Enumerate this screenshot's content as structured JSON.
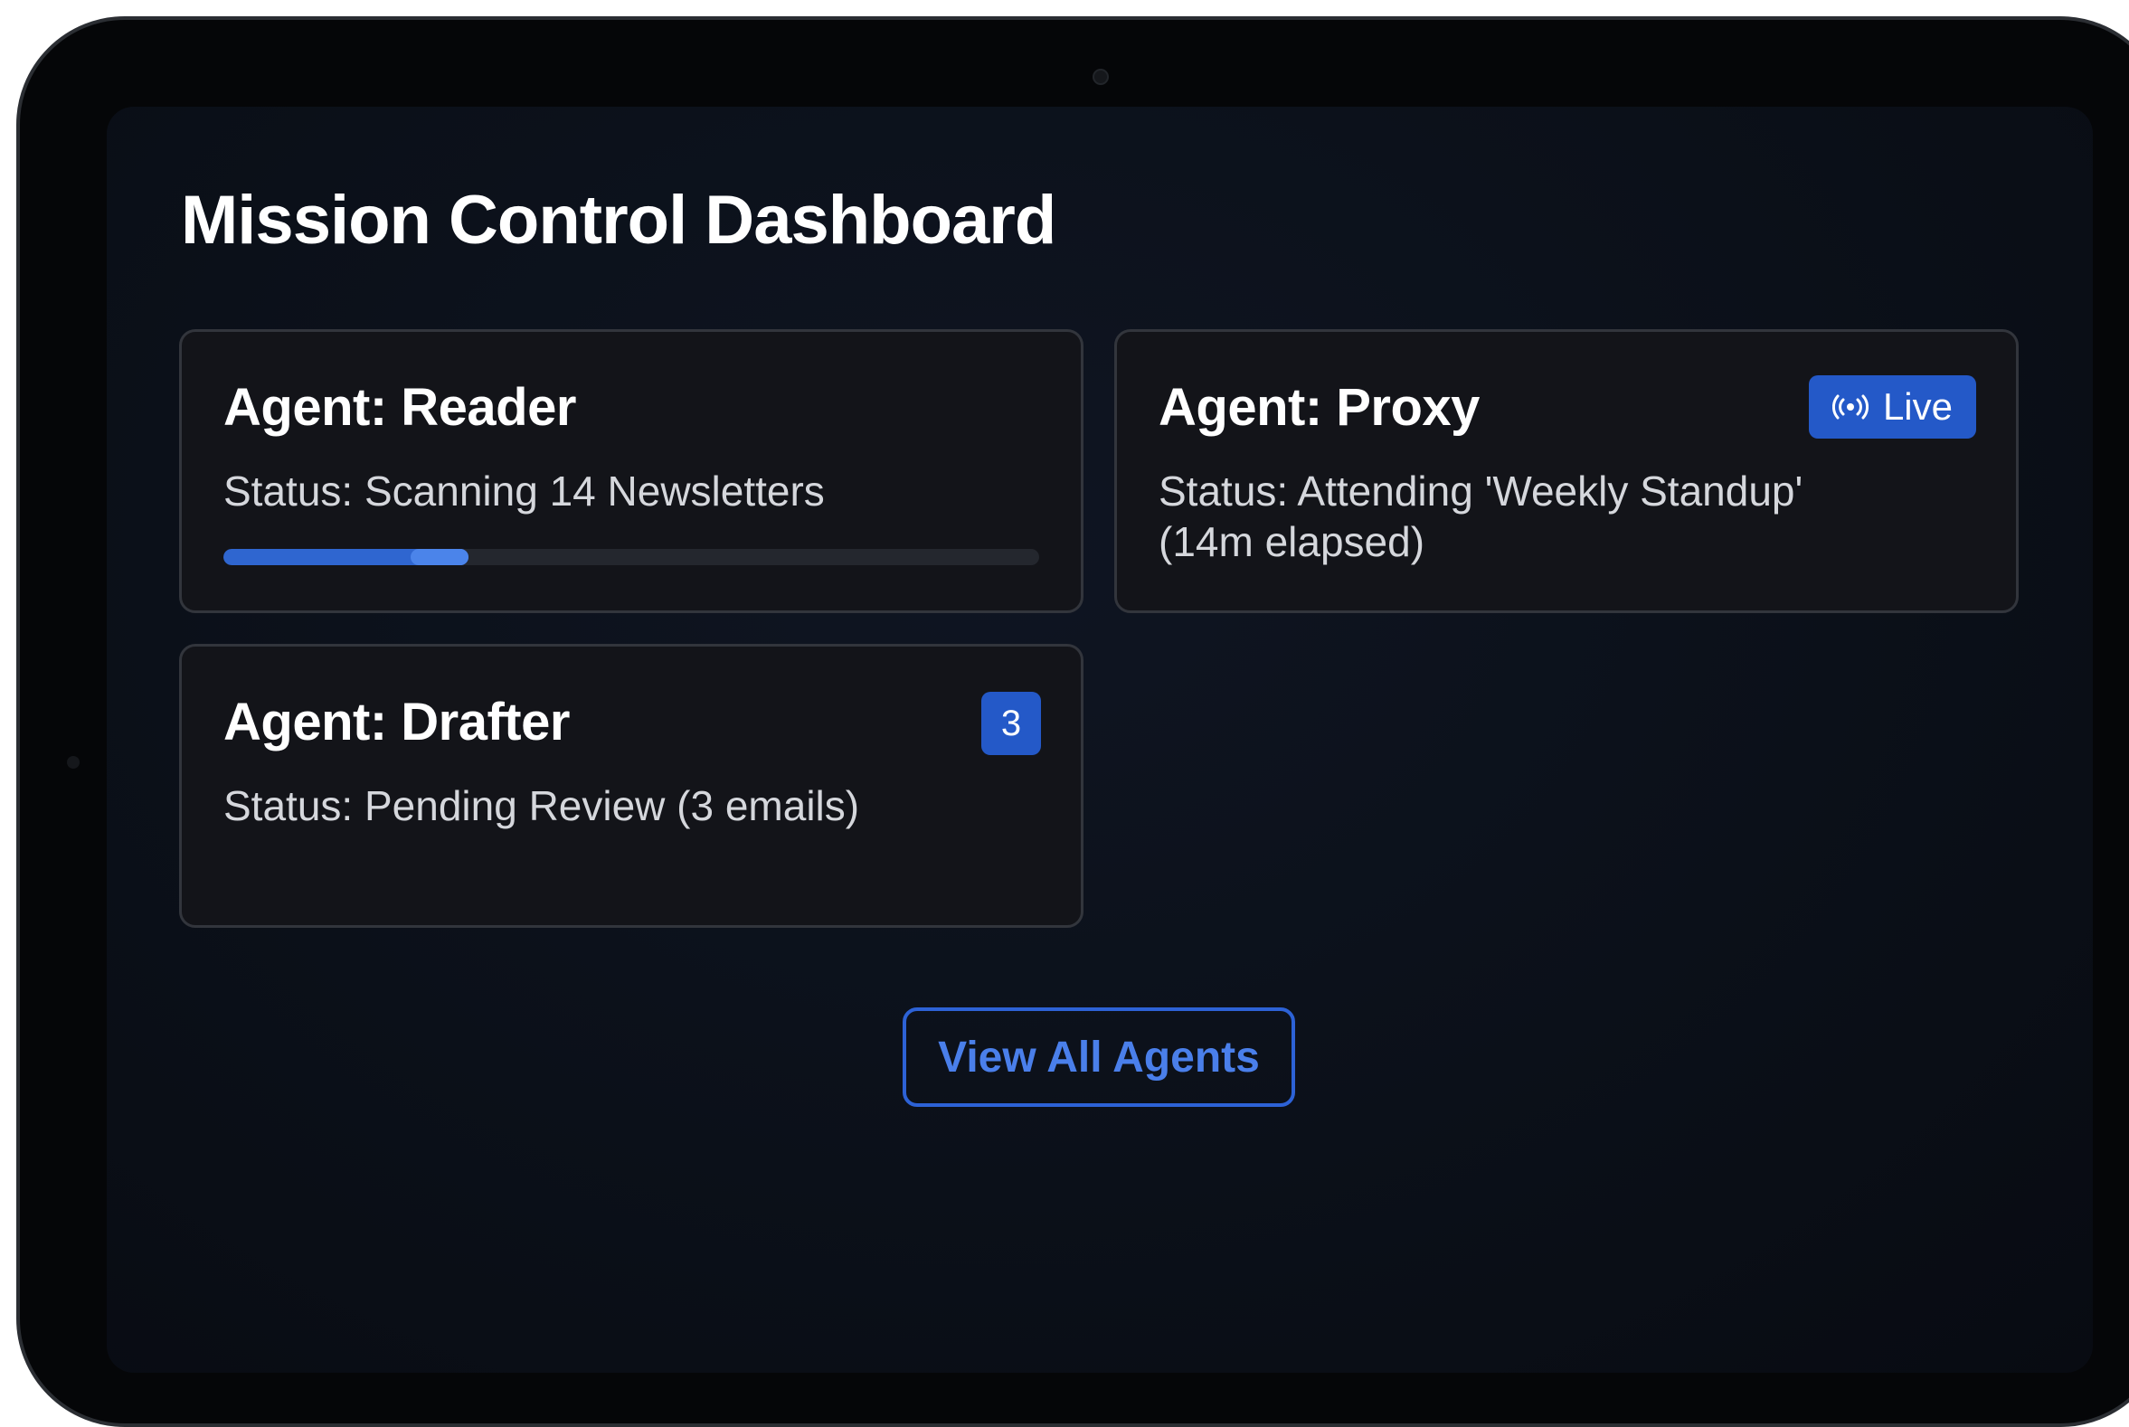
{
  "dashboard": {
    "title": "Mission Control Dashboard"
  },
  "agents": {
    "reader": {
      "title": "Agent: Reader",
      "status": "Status: Scanning 14 Newsletters",
      "progress_percent": 30
    },
    "proxy": {
      "title": "Agent: Proxy",
      "status_line1": "Status: Attending 'Weekly Standup'",
      "status_line2": "(14m elapsed)",
      "badge_label": "Live",
      "badge_icon": "broadcast-icon"
    },
    "drafter": {
      "title": "Agent: Drafter",
      "status": "Status: Pending Review (3 emails)",
      "badge_count": "3"
    }
  },
  "actions": {
    "view_all_label": "View All Agents"
  },
  "colors": {
    "accent": "#2459c8",
    "accent_text": "#4a7fea",
    "card_bg": "#131419",
    "screen_bg": "#0b1019"
  }
}
